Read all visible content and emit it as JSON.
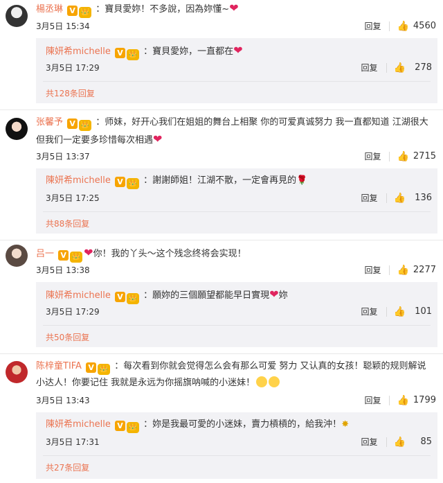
{
  "common": {
    "reply_label": "回复",
    "thumb_icon": "thumb-up-icon"
  },
  "comments": [
    {
      "user": "楊丞琳",
      "text_a": "：寶貝愛妳！不多說，因為妳懂~",
      "text_b": "",
      "time": "3月5日 15:34",
      "likes": "4560",
      "reply": {
        "user": "陳妍希michelle",
        "text": "：寶貝愛妳，一直都在",
        "time": "3月5日 17:29",
        "likes": "278"
      },
      "more": "共128条回复"
    },
    {
      "user": "张馨予",
      "text_a": "：师妹，好开心我们在姐姐的舞台上相聚 你的可爱真诚努力 我一直都知道 江湖很大",
      "text_b": "但我们一定要多珍惜每次相遇",
      "time": "3月5日 13:37",
      "likes": "2715",
      "reply": {
        "user": "陳妍希michelle",
        "text": "：謝謝師姐！江湖不散，一定會再見的",
        "time": "3月5日 17:25",
        "likes": "136"
      },
      "more": "共88条回复"
    },
    {
      "user": "吕一",
      "text_a": "你！我的丫头～这个残念终将会实现！",
      "text_b": "",
      "time": "3月5日 13:38",
      "likes": "2277",
      "reply": {
        "user": "陳妍希michelle",
        "text": "：願妳的三個願望都能早日實現",
        "text_tail": "妳",
        "time": "3月5日 17:29",
        "likes": "101"
      },
      "more": "共50条回复"
    },
    {
      "user": "陈梓童TIFA",
      "text_a": "：每次看到你就会觉得怎么会有那么可爱 努力 又认真的女孩！聪颖的规则解说",
      "text_b": "小达人！你要记住 我就是永远为你摇旗呐喊的小迷妹！",
      "time": "3月5日 13:43",
      "likes": "1799",
      "reply": {
        "user": "陳妍希michelle",
        "text": "：妳是我最可愛的小迷妹，賣力槓槓的，給我沖！",
        "time": "3月5日 17:31",
        "likes": "85"
      },
      "more": "共27条回复"
    }
  ]
}
